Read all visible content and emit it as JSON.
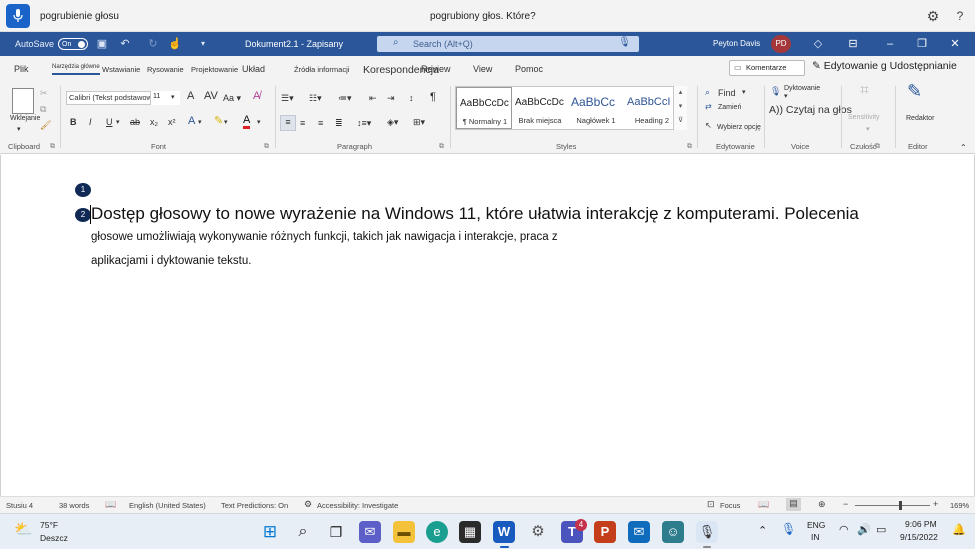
{
  "voice_access": {
    "command_text": "pogrubienie głosu",
    "feedback_text": "pogrubiony głos. Które?",
    "mic_icon": "microphone-icon",
    "settings_icon": "gear-icon",
    "help_icon": "question-icon"
  },
  "titlebar": {
    "autosave_label": "AutoSave",
    "autosave_state": "On",
    "doc_title": "Dokument2.1 - Zapisany",
    "search_placeholder": "Search (Alt+Q)",
    "user_name": "Peyton Davis",
    "user_initials": "PD",
    "accent_color": "#2b579a"
  },
  "tabs": [
    {
      "label": "Plik"
    },
    {
      "label": "Narzędzia główne",
      "active": true
    },
    {
      "label": "Wstawianie"
    },
    {
      "label": "Rysowanie"
    },
    {
      "label": "Projektowanie"
    },
    {
      "label": "Układ"
    },
    {
      "label": "Źródła informacji"
    },
    {
      "label": "Korespondencja"
    },
    {
      "label": "Review"
    },
    {
      "label": "View"
    },
    {
      "label": "Pomoc"
    }
  ],
  "tab_actions": {
    "comments": "Komentarze",
    "editing": "Edytowanie g Udostępnianie"
  },
  "ribbon": {
    "clipboard": {
      "paste": "Wklejanie",
      "label": "Clipboard"
    },
    "font": {
      "name": "Calibri (Tekst podstawowy)",
      "size": "11",
      "label": "Font",
      "bold": "B",
      "italic": "I",
      "underline": "U",
      "strike": "ab",
      "subscript": "x₂",
      "superscript": "x²"
    },
    "paragraph": {
      "label": "Paragraph"
    },
    "styles": {
      "label": "Styles",
      "items": [
        {
          "sample": "AaBbCcDc",
          "name": "¶ Normalny 1"
        },
        {
          "sample": "AaBbCcDc",
          "name": "Brak miejsca"
        },
        {
          "sample": "AaBbCc",
          "name": "Nagłówek 1"
        },
        {
          "sample": "AaBbCcI",
          "name": "Heading 2"
        }
      ]
    },
    "editing": {
      "find": "Find",
      "replace": "Zamień",
      "select": "Wybierz opcję",
      "label": "Edytowanie"
    },
    "voice": {
      "dictate": "Dyktowanie",
      "read_aloud": "A)) Czytaj na głos",
      "label": "Voice"
    },
    "sensitivity": {
      "button": "Sensitivity",
      "label": "Czułość"
    },
    "editor": {
      "button": "Redaktor",
      "label": "Editor"
    }
  },
  "document": {
    "badges": [
      "1",
      "2"
    ],
    "line1": "Dostęp głosowy to nowe wyrażenie na Windows 11, które ułatwia interakcję z komputerami. Polecenia",
    "line2": "głosowe umożliwiają wykonywanie różnych funkcji, takich jak nawigacja i interakcje, praca z",
    "line3": "aplikacjami i dyktowanie tekstu."
  },
  "statusbar": {
    "page": "Stusiu 4",
    "words": "38 words",
    "language": "English (United States)",
    "predictions": "Text Predictions: On",
    "accessibility": "Accessibility: Investigate",
    "focus": "Focus",
    "zoom": "169%",
    "zoom_level_fraction": 0.6
  },
  "taskbar": {
    "weather_temp": "75°F",
    "weather_desc": "Deszcz",
    "teams_badge": "4",
    "lang_line1": "ENG",
    "lang_line2": "IN",
    "time": "9:06 PM",
    "date": "9/15/2022"
  }
}
